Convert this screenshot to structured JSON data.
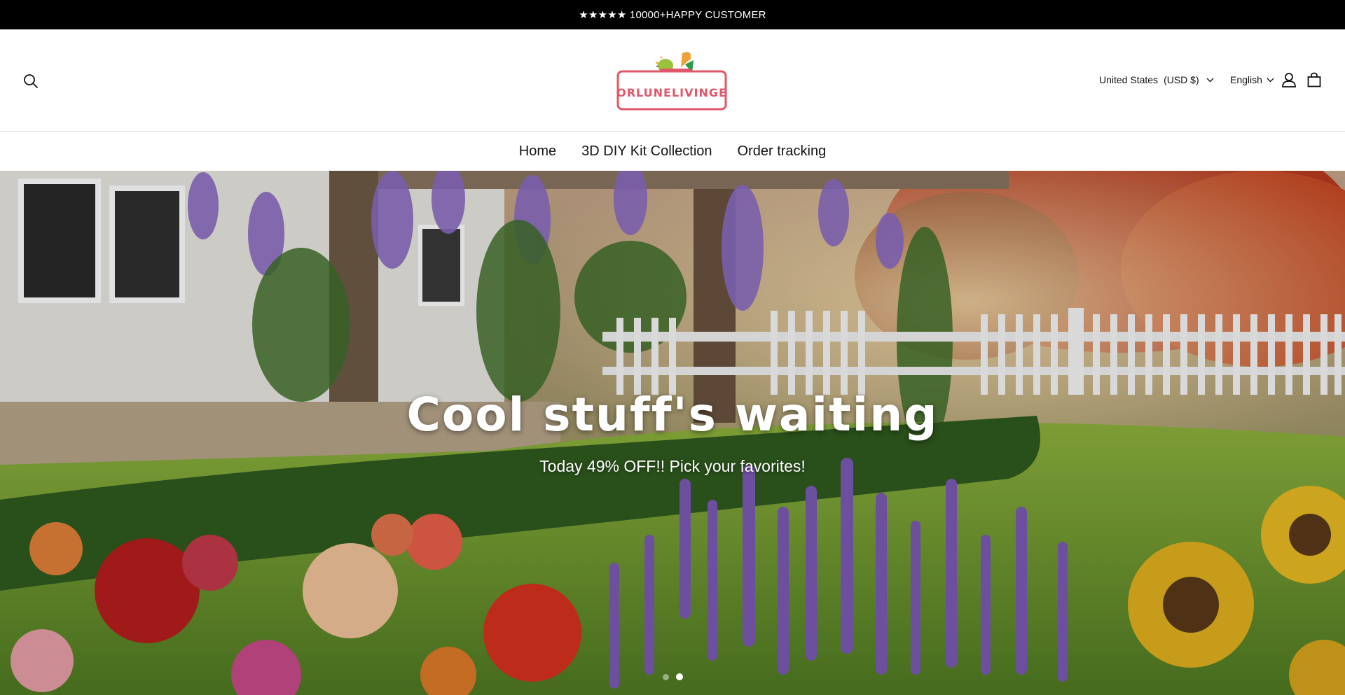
{
  "announcement": {
    "text": "★★★★★ 10000+HAPPY CUSTOMER"
  },
  "header": {
    "logo_text": "ORLUNELIVINGE",
    "country": "United States",
    "currency": "(USD $)",
    "language": "English"
  },
  "nav": {
    "items": [
      {
        "label": "Home"
      },
      {
        "label": "3D DIY Kit Collection"
      },
      {
        "label": "Order tracking"
      }
    ]
  },
  "hero": {
    "title": "Cool stuff's waiting",
    "subtitle": "Today 49% OFF!! Pick your favorites!",
    "slide_count": 2,
    "active_slide": 2
  },
  "colors": {
    "announcement_bg": "#000000",
    "logo_accent": "#e0566a",
    "text": "#121212"
  },
  "icons": [
    "search-icon",
    "chevron-down-icon",
    "account-icon",
    "cart-icon",
    "logo-basket-icon"
  ]
}
